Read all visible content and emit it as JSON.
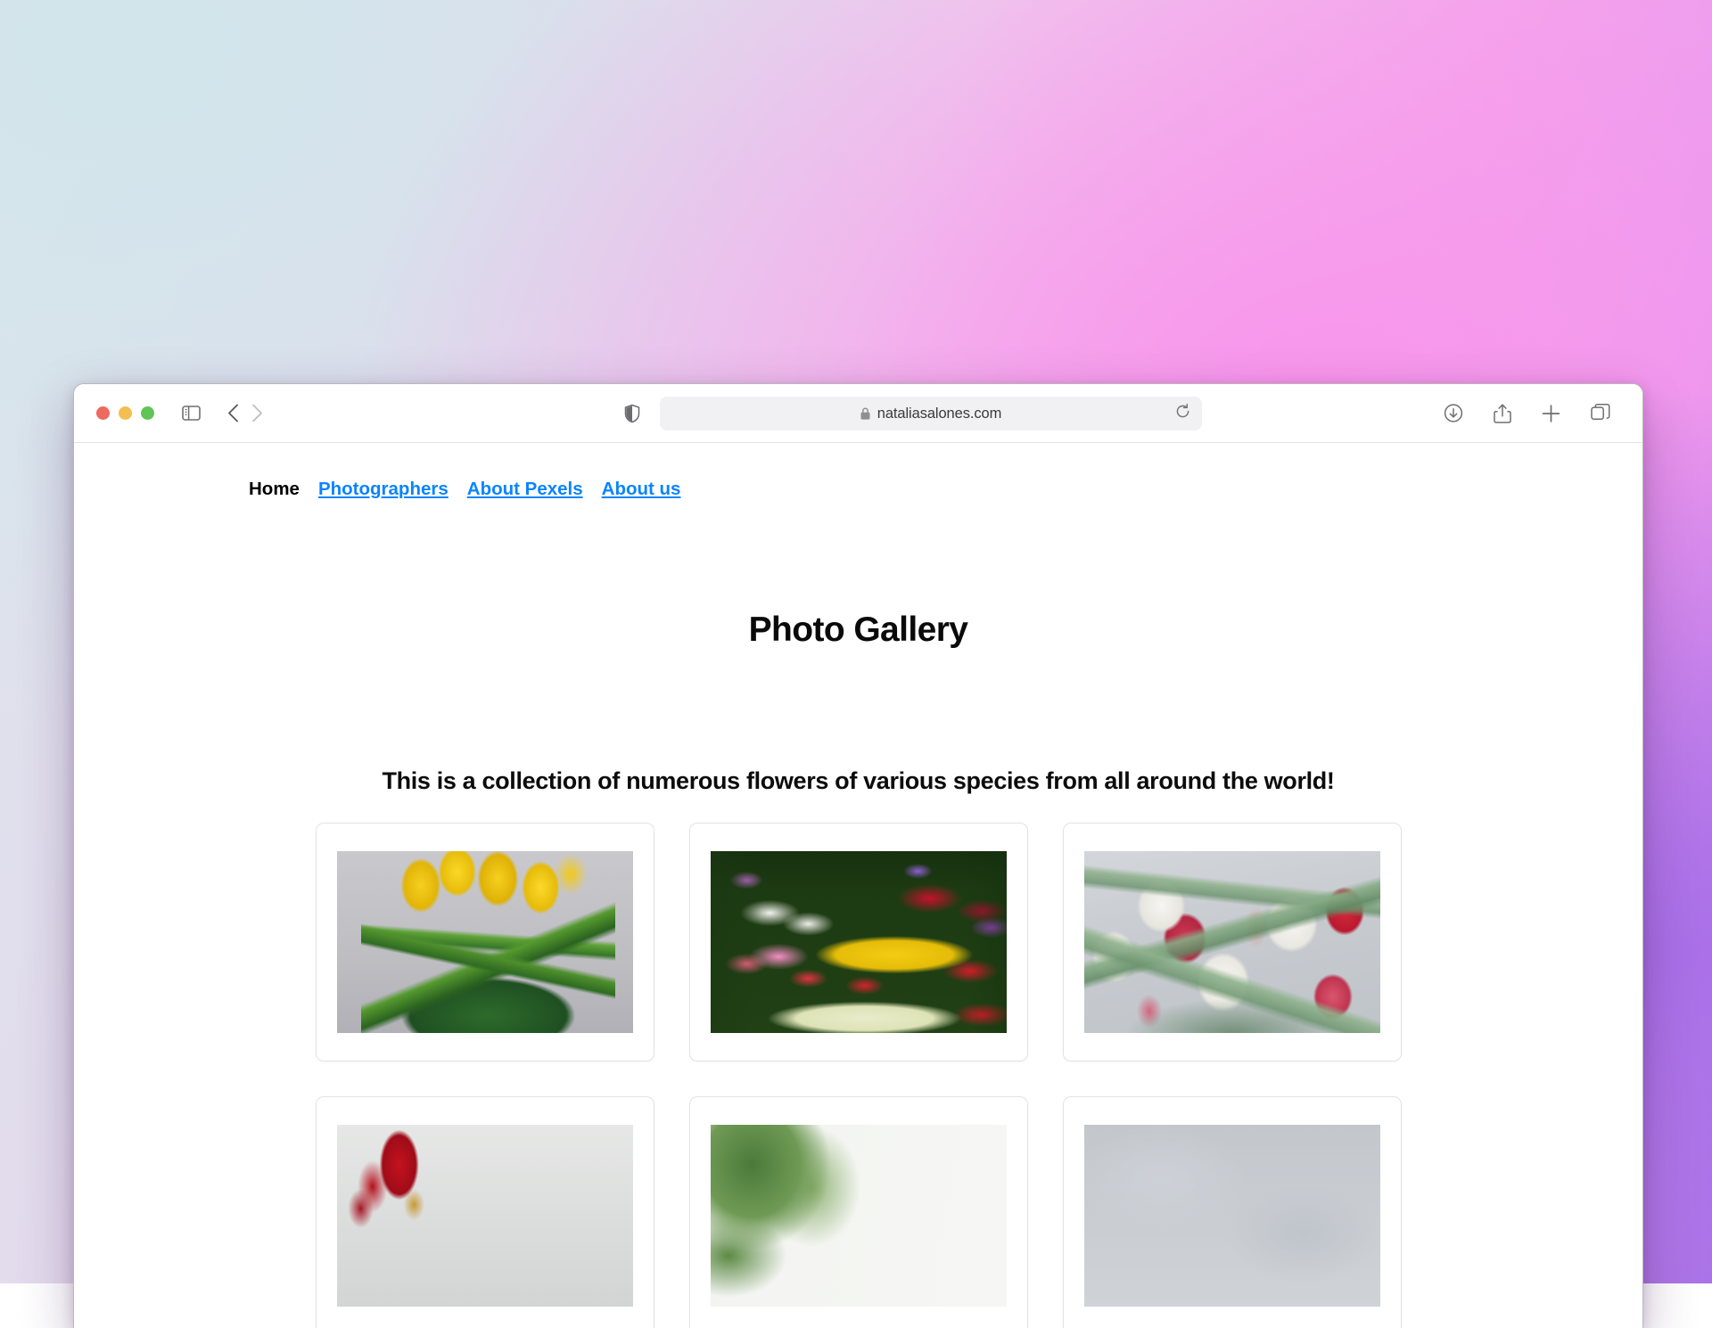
{
  "browser": {
    "window_controls": [
      {
        "name": "close",
        "color": "#ec6a5e"
      },
      {
        "name": "minimize",
        "color": "#f4bf50"
      },
      {
        "name": "maximize",
        "color": "#61c454"
      }
    ],
    "toolbar_icons": {
      "sidebar": "sidebar-icon",
      "back": "back-chevron-icon",
      "forward": "forward-chevron-icon",
      "shield": "privacy-shield-icon",
      "lock": "lock-icon",
      "reload": "reload-icon",
      "downloads": "downloads-icon",
      "share": "share-icon",
      "new_tab": "plus-icon",
      "tab_overview": "tab-overview-icon"
    },
    "url": "nataliasalones.com"
  },
  "site": {
    "nav": [
      {
        "label": "Home",
        "active": true
      },
      {
        "label": "Photographers",
        "active": false
      },
      {
        "label": "About Pexels",
        "active": false
      },
      {
        "label": "About us",
        "active": false
      }
    ],
    "title": "Photo Gallery",
    "subtitle": "This is a collection of numerous flowers of various species from all around the world!",
    "link_color": "#0a84ff",
    "gallery": [
      {
        "alt": "Yellow tulips in a green glass vase",
        "art": "p-yellow-vase"
      },
      {
        "alt": "Colorful tulip field with white, red, yellow and pink blooms",
        "art": "p-field"
      },
      {
        "alt": "White and red tulips close up",
        "art": "p-white-red"
      },
      {
        "alt": "Red flower on light background",
        "art": "p-red-white"
      },
      {
        "alt": "Green foliage with white background",
        "art": "p-green-white"
      },
      {
        "alt": "Soft gray toned flower photo",
        "art": "p-gray"
      }
    ]
  }
}
